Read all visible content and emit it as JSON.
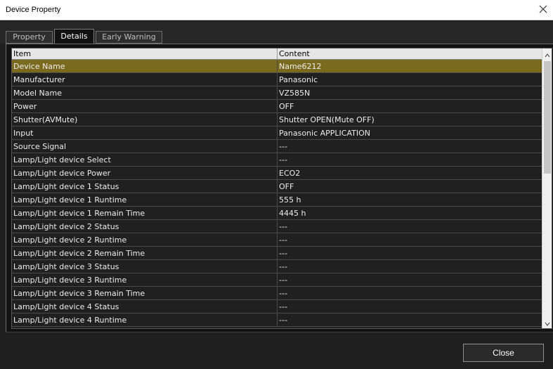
{
  "window": {
    "title": "Device Property"
  },
  "tabs": [
    {
      "label": "Property",
      "active": false
    },
    {
      "label": "Details",
      "active": true
    },
    {
      "label": "Early Warning",
      "active": false
    }
  ],
  "table": {
    "headers": {
      "item": "Item",
      "content": "Content"
    },
    "rows": [
      {
        "item": "Device Name",
        "content": "Name6212",
        "selected": true
      },
      {
        "item": "Manufacturer",
        "content": "Panasonic"
      },
      {
        "item": "Model Name",
        "content": "VZ585N"
      },
      {
        "item": "Power",
        "content": "OFF"
      },
      {
        "item": "Shutter(AVMute)",
        "content": "Shutter OPEN(Mute OFF)"
      },
      {
        "item": "Input",
        "content": "Panasonic APPLICATION"
      },
      {
        "item": "Source Signal",
        "content": "---"
      },
      {
        "item": "Lamp/Light device Select",
        "content": "---"
      },
      {
        "item": "Lamp/Light device Power",
        "content": "ECO2"
      },
      {
        "item": "Lamp/Light device 1 Status",
        "content": "OFF"
      },
      {
        "item": "Lamp/Light device 1 Runtime",
        "content": "555 h"
      },
      {
        "item": "Lamp/Light device 1 Remain Time",
        "content": "4445 h"
      },
      {
        "item": "Lamp/Light device 2 Status",
        "content": "---"
      },
      {
        "item": "Lamp/Light device 2 Runtime",
        "content": "---"
      },
      {
        "item": "Lamp/Light device 2 Remain Time",
        "content": "---"
      },
      {
        "item": "Lamp/Light device 3 Status",
        "content": "---"
      },
      {
        "item": "Lamp/Light device 3 Runtime",
        "content": "---"
      },
      {
        "item": "Lamp/Light device 3 Remain Time",
        "content": "---"
      },
      {
        "item": "Lamp/Light device 4 Status",
        "content": "---"
      },
      {
        "item": "Lamp/Light device 4 Runtime",
        "content": "---"
      }
    ]
  },
  "buttons": {
    "close_label": "Close"
  },
  "icons": {
    "window_close": "close-icon",
    "scroll_up": "chevron-up-icon",
    "scroll_down": "chevron-down-icon"
  },
  "colors": {
    "selected_row": "#7a6a1e",
    "background": "#1f1f1f",
    "header": "#e6e6e6"
  }
}
